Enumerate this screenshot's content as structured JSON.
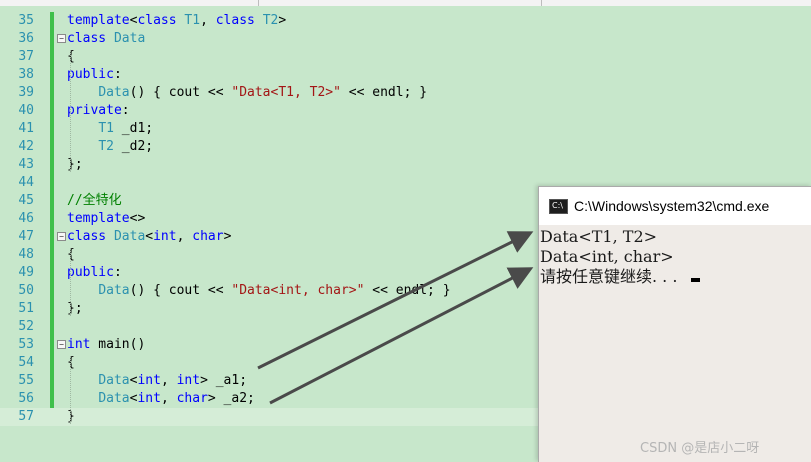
{
  "editor": {
    "lines": [
      {
        "n": "35",
        "fold": "",
        "parts": [
          [
            "kw",
            "template"
          ],
          [
            "",
            "<"
          ],
          [
            "kw",
            "class"
          ],
          [
            "ty",
            " T1"
          ],
          [
            "",
            ", "
          ],
          [
            "kw",
            "class"
          ],
          [
            "ty",
            " T2"
          ],
          [
            "",
            ">"
          ]
        ]
      },
      {
        "n": "36",
        "fold": "−",
        "parts": [
          [
            "kw",
            "class"
          ],
          [
            "ty",
            " Data"
          ]
        ]
      },
      {
        "n": "37",
        "fold": "",
        "parts": [
          [
            "",
            "{"
          ]
        ]
      },
      {
        "n": "38",
        "fold": "",
        "parts": [
          [
            "kw",
            "public"
          ],
          [
            "",
            ":"
          ]
        ]
      },
      {
        "n": "39",
        "fold": "",
        "parts": [
          [
            "",
            "    "
          ],
          [
            "ty",
            "Data"
          ],
          [
            "",
            "() { cout << "
          ],
          [
            "str",
            "\"Data<T1, T2>\""
          ],
          [
            "",
            " << endl; }"
          ]
        ]
      },
      {
        "n": "40",
        "fold": "",
        "parts": [
          [
            "kw",
            "private"
          ],
          [
            "",
            ":"
          ]
        ]
      },
      {
        "n": "41",
        "fold": "",
        "parts": [
          [
            "",
            "    "
          ],
          [
            "ty",
            "T1"
          ],
          [
            "",
            " _d1;"
          ]
        ]
      },
      {
        "n": "42",
        "fold": "",
        "parts": [
          [
            "",
            "    "
          ],
          [
            "ty",
            "T2"
          ],
          [
            "",
            " _d2;"
          ]
        ]
      },
      {
        "n": "43",
        "fold": "",
        "parts": [
          [
            "",
            "};"
          ]
        ]
      },
      {
        "n": "44",
        "fold": "",
        "parts": []
      },
      {
        "n": "45",
        "fold": "",
        "parts": [
          [
            "cm",
            "//全特化"
          ]
        ]
      },
      {
        "n": "46",
        "fold": "",
        "parts": [
          [
            "kw",
            "template"
          ],
          [
            "",
            "<>"
          ]
        ]
      },
      {
        "n": "47",
        "fold": "−",
        "parts": [
          [
            "kw",
            "class"
          ],
          [
            "ty",
            " Data"
          ],
          [
            "",
            "<"
          ],
          [
            "kw",
            "int"
          ],
          [
            "",
            ", "
          ],
          [
            "kw",
            "char"
          ],
          [
            "",
            ">"
          ]
        ]
      },
      {
        "n": "48",
        "fold": "",
        "parts": [
          [
            "",
            "{"
          ]
        ]
      },
      {
        "n": "49",
        "fold": "",
        "parts": [
          [
            "kw",
            "public"
          ],
          [
            "",
            ":"
          ]
        ]
      },
      {
        "n": "50",
        "fold": "",
        "parts": [
          [
            "",
            "    "
          ],
          [
            "ty",
            "Data"
          ],
          [
            "",
            "() { cout << "
          ],
          [
            "str",
            "\"Data<int, char>\""
          ],
          [
            "",
            " << endl; }"
          ]
        ]
      },
      {
        "n": "51",
        "fold": "",
        "parts": [
          [
            "",
            "};"
          ]
        ]
      },
      {
        "n": "52",
        "fold": "",
        "parts": []
      },
      {
        "n": "53",
        "fold": "−",
        "parts": [
          [
            "kw",
            "int"
          ],
          [
            "",
            " main()"
          ]
        ]
      },
      {
        "n": "54",
        "fold": "",
        "parts": [
          [
            "",
            "{"
          ]
        ]
      },
      {
        "n": "55",
        "fold": "",
        "parts": [
          [
            "",
            "    "
          ],
          [
            "ty",
            "Data"
          ],
          [
            "",
            "<"
          ],
          [
            "kw",
            "int"
          ],
          [
            "",
            ", "
          ],
          [
            "kw",
            "int"
          ],
          [
            "",
            "> _a1;"
          ]
        ]
      },
      {
        "n": "56",
        "fold": "",
        "parts": [
          [
            "",
            "    "
          ],
          [
            "ty",
            "Data"
          ],
          [
            "",
            "<"
          ],
          [
            "kw",
            "int"
          ],
          [
            "",
            ", "
          ],
          [
            "kw",
            "char"
          ],
          [
            "",
            "> _a2;"
          ]
        ]
      },
      {
        "n": "57",
        "fold": "",
        "parts": [
          [
            "",
            "}"
          ]
        ]
      }
    ]
  },
  "console": {
    "title": "C:\\Windows\\system32\\cmd.exe",
    "line1": "Data<T1, T2>",
    "line2": "Data<int, char>",
    "line3": "请按任意键继续. . . "
  },
  "watermark": "CSDN @是店小二呀",
  "colors": {
    "editor_bg": "#c7e7cb",
    "keyword": "#0000ff",
    "type": "#2b91af",
    "string": "#a31515",
    "comment": "#008000",
    "arrow": "#4a4a4a"
  }
}
